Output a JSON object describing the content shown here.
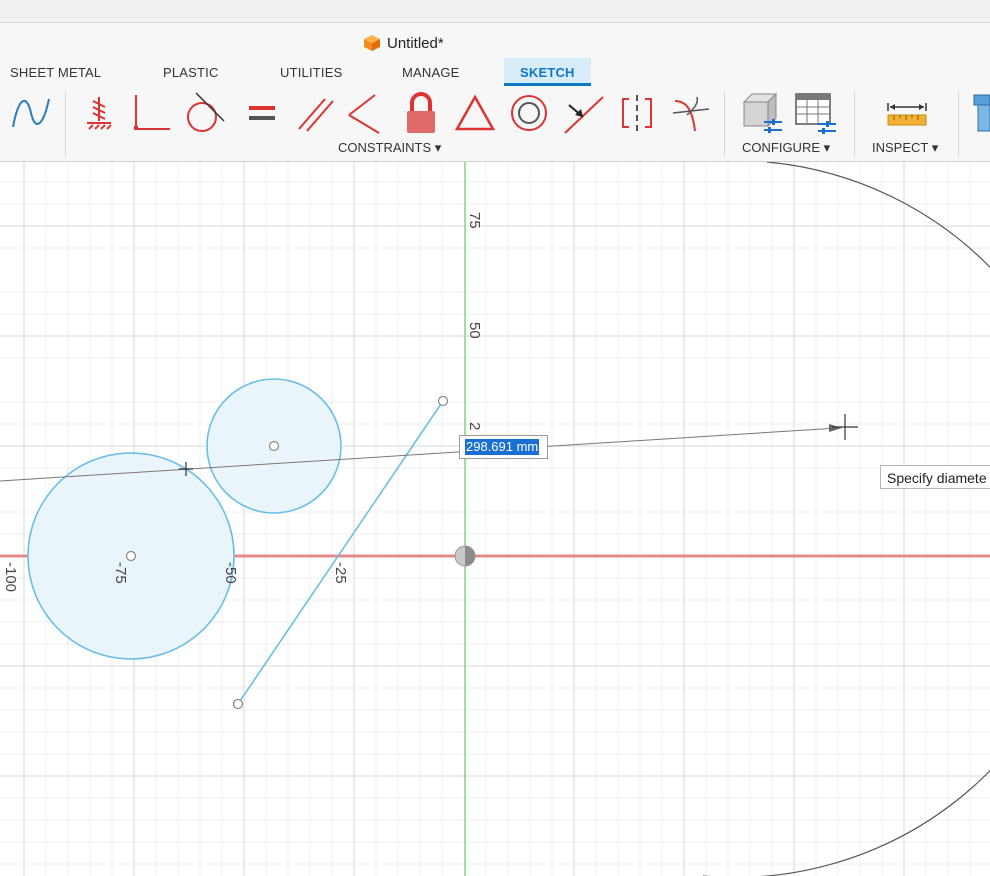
{
  "window": {
    "title": "Untitled*"
  },
  "tabs": [
    {
      "label": "SHEET METAL"
    },
    {
      "label": "PLASTIC"
    },
    {
      "label": "UTILITIES"
    },
    {
      "label": "MANAGE"
    },
    {
      "label": "SKETCH",
      "active": true
    }
  ],
  "toolbar": {
    "tools": [
      {
        "icon": "spline-icon"
      },
      {
        "icon": "fix-constraint-icon"
      },
      {
        "icon": "perpendicular-constraint-icon"
      },
      {
        "icon": "tangent-constraint-icon"
      },
      {
        "icon": "equal-constraint-icon"
      },
      {
        "icon": "parallel-constraint-icon"
      },
      {
        "icon": "collinear-constraint-icon"
      },
      {
        "icon": "lock-constraint-icon"
      },
      {
        "icon": "triangle-constraint-icon"
      },
      {
        "icon": "concentric-constraint-icon"
      },
      {
        "icon": "midpoint-constraint-icon"
      },
      {
        "icon": "symmetry-constraint-icon"
      },
      {
        "icon": "curvature-constraint-icon"
      },
      {
        "icon": "configure-model-icon"
      },
      {
        "icon": "configure-table-icon"
      },
      {
        "icon": "measure-icon"
      },
      {
        "icon": "fastener-icon"
      }
    ],
    "groups": {
      "constraints": "CONSTRAINTS ▾",
      "configure": "CONFIGURE ▾",
      "inspect": "INSPECT ▾"
    }
  },
  "sketch": {
    "axis_labels": {
      "y_75": "75",
      "y_50": "50",
      "y_25": "2",
      "x_m100": "-100",
      "x_m75": "-75",
      "x_m50": "-50",
      "x_m25": "-25"
    },
    "diameter_input": {
      "value": "298.691 mm"
    },
    "tooltip": "Specify diamete",
    "colors": {
      "grid": "#e4e4e4",
      "x_axis": "#e06060",
      "y_axis": "#6fcf6f",
      "sketch_line": "#6bbfe6",
      "circle_fill": "#eaf4fb",
      "accent": "#0b79c7"
    }
  }
}
